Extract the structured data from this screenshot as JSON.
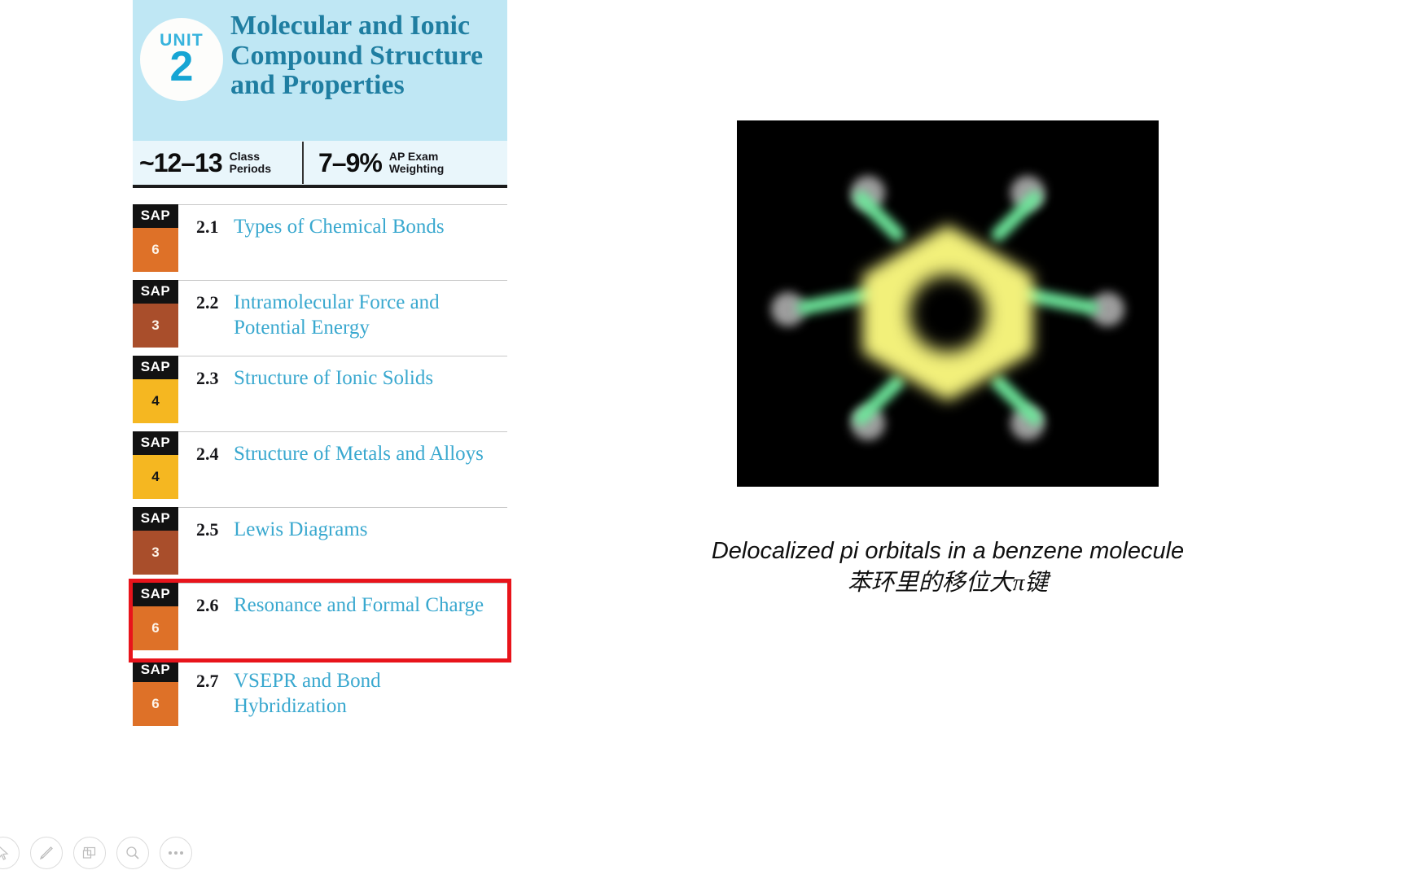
{
  "unit": {
    "badge_word": "UNIT",
    "badge_number": "2",
    "title": "Molecular and Ionic Compound Structure and Properties",
    "header_bg": "#bfe7f4",
    "title_color": "#1f7ea1",
    "accent_color": "#16a5d4",
    "stats": [
      {
        "value": "~12–13",
        "label_line1": "Class",
        "label_line2": "Periods"
      },
      {
        "value": "7–9%",
        "label_line1": "AP Exam",
        "label_line2": "Weighting"
      }
    ]
  },
  "topics": [
    {
      "tag": "SAP",
      "count": "6",
      "count_color": "#de7128",
      "count_text_color": "#fdf3e8",
      "code": "2.1",
      "name": "Types of Chemical Bonds",
      "highlighted": false
    },
    {
      "tag": "SAP",
      "count": "3",
      "count_color": "#a94e2b",
      "count_text_color": "#fdf3e8",
      "code": "2.2",
      "name": "Intramolecular Force and Potential Energy",
      "highlighted": false
    },
    {
      "tag": "SAP",
      "count": "4",
      "count_color": "#f5b721",
      "count_text_color": "#161616",
      "code": "2.3",
      "name": "Structure of Ionic Solids",
      "highlighted": false
    },
    {
      "tag": "SAP",
      "count": "4",
      "count_color": "#f5b721",
      "count_text_color": "#161616",
      "code": "2.4",
      "name": "Structure of Metals and Alloys",
      "highlighted": false
    },
    {
      "tag": "SAP",
      "count": "3",
      "count_color": "#a94e2b",
      "count_text_color": "#fdf3e8",
      "code": "2.5",
      "name": "Lewis Diagrams",
      "highlighted": false
    },
    {
      "tag": "SAP",
      "count": "6",
      "count_color": "#de7128",
      "count_text_color": "#fdf3e8",
      "code": "2.6",
      "name": "Resonance and Formal Charge",
      "highlighted": true
    },
    {
      "tag": "SAP",
      "count": "6",
      "count_color": "#de7128",
      "count_text_color": "#fdf3e8",
      "code": "2.7",
      "name": "VSEPR and Bond Hybridization",
      "highlighted": false
    }
  ],
  "highlight_color": "#e8141b",
  "figure": {
    "alt_name": "benzene-delocalized-pi-orbital-render",
    "background": "#000000",
    "ring_color": "#f2f07a",
    "bond_color": "#6ee79b",
    "atom_color": "#cccccc",
    "caption_en": "Delocalized pi orbitals in a benzene molecule",
    "caption_cn": "苯环里的移位大π键"
  },
  "toolbar": {
    "items": [
      {
        "icon": "pointer-icon",
        "label": "Select"
      },
      {
        "icon": "pen-icon",
        "label": "Pen"
      },
      {
        "icon": "layers-icon",
        "label": "Layers"
      },
      {
        "icon": "magnifier-icon",
        "label": "Zoom"
      },
      {
        "icon": "more-icon",
        "label": "More"
      }
    ]
  }
}
